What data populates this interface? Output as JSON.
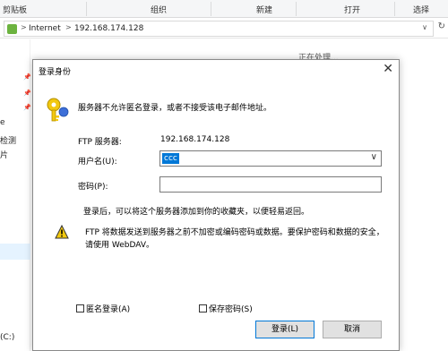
{
  "ribbon": {
    "groups": [
      "剪贴板",
      "组织",
      "新建",
      "打开",
      "选择"
    ]
  },
  "address": {
    "crumbs": [
      "Internet",
      "192.168.174.128"
    ]
  },
  "status": "正在处理...",
  "leftpane": {
    "fragments": [
      "e",
      "检测",
      "片",
      "(C:)"
    ]
  },
  "dialog": {
    "title": "登录身份",
    "message": "服务器不允许匿名登录，或者不接受该电子邮件地址。",
    "server_label": "FTP 服务器:",
    "server_value": "192.168.174.128",
    "user_label": "用户名(U):",
    "user_value": "ccc",
    "password_label": "密码(P):",
    "note": "登录后，可以将这个服务器添加到你的收藏夹，以便轻易返回。",
    "warning": "FTP 将数据发送到服务器之前不加密或编码密码或数据。要保护密码和数据的安全，请使用 WebDAV。",
    "anon_label": "匿名登录(A)",
    "save_pw_label": "保存密码(S)",
    "login_button": "登录(L)",
    "cancel_button": "取消"
  },
  "colors": {
    "selection": "#0078d7",
    "warning": "#f2c80f",
    "nav_selected": "#e5f3ff"
  }
}
